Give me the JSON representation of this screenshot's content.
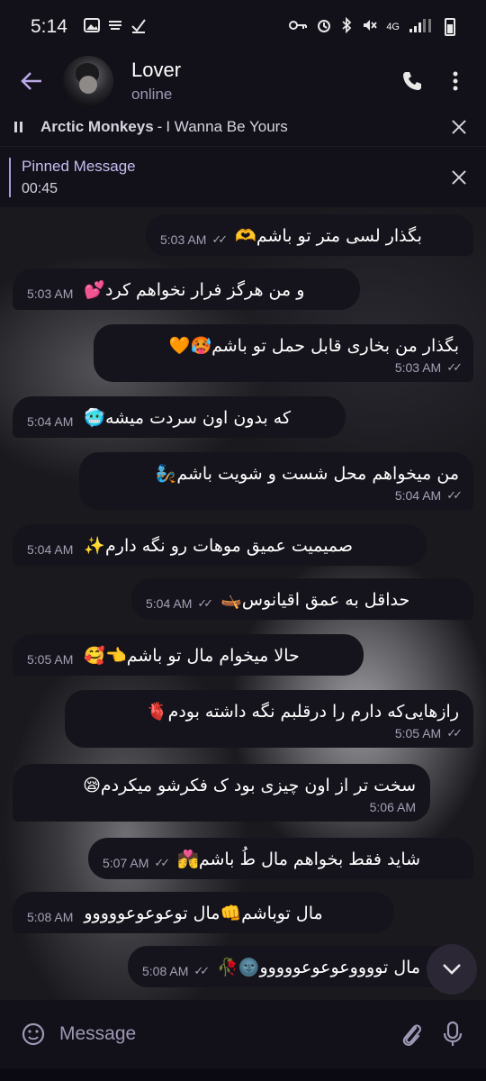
{
  "status_bar": {
    "time": "5:14",
    "network": "4G",
    "icons": [
      "image-icon",
      "check-icon",
      "key-icon",
      "alarm-icon",
      "bluetooth-icon",
      "mute-icon",
      "signal-icon",
      "battery-icon"
    ]
  },
  "header": {
    "title": "Lover",
    "status": "online",
    "icons": [
      "back-arrow-icon",
      "phone-icon",
      "more-vertical-icon"
    ]
  },
  "music": {
    "artist": "Arctic Monkeys",
    "separator": "-",
    "song": "I Wanna Be Yours"
  },
  "pinned": {
    "title": "Pinned Message",
    "text": "00:45"
  },
  "messages": [
    {
      "text": "بگذار لسی متر تو باشم🫶",
      "time": "5:03 AM",
      "out": true,
      "read": true
    },
    {
      "text": "و من هرگز فرار نخواهم کرد💕",
      "time": "5:03 AM",
      "out": false
    },
    {
      "text": "بگذار من بخاری قابل حمل تو باشم🥵🧡",
      "time": "5:03 AM",
      "out": true,
      "read": true
    },
    {
      "text": "که بدون اون سردت میشه🥶",
      "time": "5:04 AM",
      "out": false
    },
    {
      "text": "من میخواهم محل شست و شویت باشم🧞",
      "time": "5:04 AM",
      "out": true,
      "read": true
    },
    {
      "text": "صمیمیت عمیق موهات رو نگه دارم✨",
      "time": "5:04 AM",
      "out": false
    },
    {
      "text": "حداقل به عمق اقیانوس🛶",
      "time": "5:04 AM",
      "out": true,
      "read": true
    },
    {
      "text": "حالا میخوام مال تو باشم👈🥰",
      "time": "5:05 AM",
      "out": false
    },
    {
      "text": "رازهایی‌که دارم را درقلبم نگه داشته بودم🫀",
      "time": "5:05 AM",
      "out": true,
      "read": true
    },
    {
      "text": "سخت تر از اون چیزی بود ک فکرشو میکردم😪",
      "time": "5:06 AM",
      "out": false
    },
    {
      "text": "شاید فقط بخواهم مال طُ باشم💏",
      "time": "5:07 AM",
      "out": true,
      "read": true
    },
    {
      "text": "مال توباشم👊مال توعوعوعووووو",
      "time": "5:08 AM",
      "out": false
    },
    {
      "text": "مال تووووعوعوعووووو🌚🥀",
      "time": "5:08 AM",
      "out": true,
      "read": true
    }
  ],
  "input": {
    "placeholder": "Message",
    "icons": [
      "emoji-icon",
      "paperclip-icon",
      "microphone-icon"
    ]
  },
  "colors": {
    "accent": "#b9a9e8",
    "bubble": "#15141c",
    "bar": "#121019",
    "meta": "#a6a1b6"
  }
}
